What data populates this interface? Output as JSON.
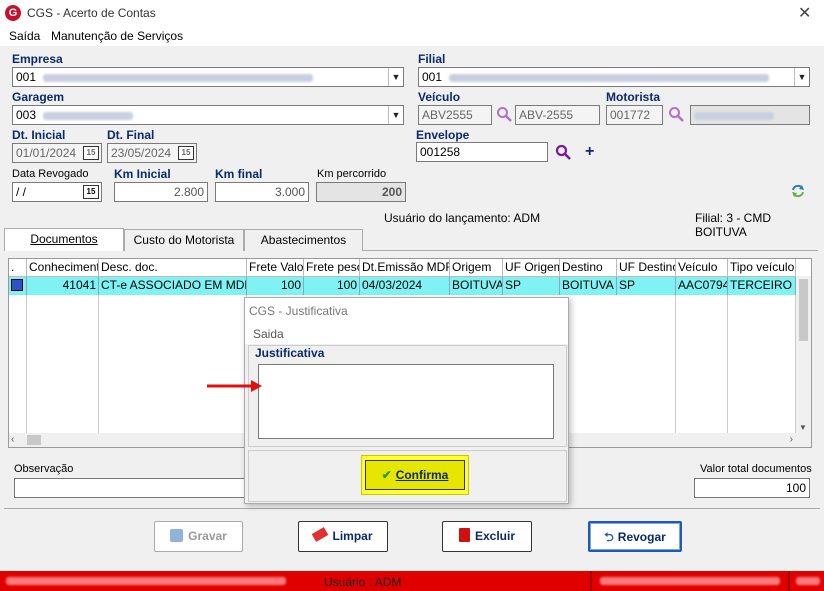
{
  "window": {
    "title": "CGS - Acerto de Contas"
  },
  "menu": [
    {
      "label": "Saída"
    },
    {
      "label": "Manutenção de Serviços"
    }
  ],
  "form": {
    "empresa": {
      "label": "Empresa",
      "value": "001"
    },
    "filial": {
      "label": "Filial",
      "value": "001"
    },
    "garagem": {
      "label": "Garagem",
      "value": "003"
    },
    "veiculo": {
      "label": "Veículo",
      "code": "ABV2555",
      "value": "ABV-2555"
    },
    "motorista": {
      "label": "Motorista",
      "code": "001772"
    },
    "dt_inicial": {
      "label": "Dt. Inicial",
      "value": "01/01/2024"
    },
    "dt_final": {
      "label": "Dt. Final",
      "value": "23/05/2024"
    },
    "envelope": {
      "label": "Envelope",
      "value": "001258"
    },
    "data_revogado": {
      "label": "Data Revogado",
      "value": " / /"
    },
    "km_inicial": {
      "label": "Km Inicial",
      "value": "2.800"
    },
    "km_final": {
      "label": "Km final",
      "value": "3.000"
    },
    "km_percorrido": {
      "label": "Km percorrido",
      "value": "200"
    }
  },
  "info": {
    "usuario": "Usuário do lançamento: ADM",
    "filial": "Filial: 3 - CMD BOITUVA"
  },
  "tabs": [
    {
      "label": "Documentos"
    },
    {
      "label": "Custo do Motorista"
    },
    {
      "label": "Abastecimentos"
    }
  ],
  "grid": {
    "columns": [
      ".",
      "Conhecimento",
      "Desc. doc.",
      "Frete Valor",
      "Frete peso",
      "Dt.Emissão MDFe",
      "Origem",
      "UF Origem",
      "Destino",
      "UF Destino",
      "Veículo",
      "Tipo veículo"
    ],
    "rows": [
      [
        "",
        "41041",
        "CT-e ASSOCIADO EM MDF-e",
        "100",
        "100",
        "04/03/2024",
        "BOITUVA",
        "SP",
        "BOITUVA",
        "SP",
        "AAC0794",
        "TERCEIRO / ..."
      ]
    ]
  },
  "observacao": {
    "label": "Observação"
  },
  "valor_total": {
    "label": "Valor total documentos",
    "value": "100"
  },
  "buttons": {
    "gravar": "Gravar",
    "limpar": "Limpar",
    "excluir": "Excluir",
    "revogar": "Revogar"
  },
  "status": {
    "usuario": "Usuário : ADM"
  },
  "dialog": {
    "title": "CGS - Justificativa",
    "menu": "Saida",
    "group_label": "Justificativa",
    "confirm": "Confirma"
  },
  "colors": {
    "highlight_row": "#7ff3f3",
    "status_red": "#e00000",
    "confirm_yellow": "#ffff33",
    "label_blue": "#0a2a6b"
  }
}
